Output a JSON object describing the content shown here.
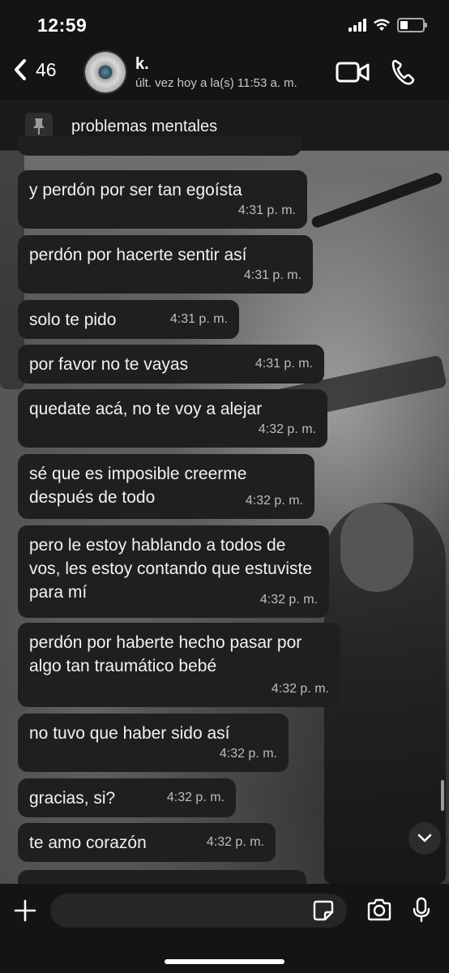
{
  "status_bar": {
    "time": "12:59"
  },
  "header": {
    "back_count": "46",
    "contact_name": "k.",
    "last_seen": "últ. vez hoy a la(s) 11:53 a. m."
  },
  "pinned": {
    "text": "problemas mentales"
  },
  "messages": [
    {
      "text": "y perdón por ser tan egoísta",
      "time": "4:31 p. m."
    },
    {
      "text": "perdón por hacerte sentir así",
      "time": "4:31 p. m."
    },
    {
      "text": "solo te pido",
      "time": "4:31 p. m."
    },
    {
      "text": "por favor no te vayas",
      "time": "4:31 p. m."
    },
    {
      "text": "quedate acá, no te voy a alejar",
      "time": "4:32 p. m."
    },
    {
      "text": "sé que es imposible creerme después de todo",
      "time": "4:32 p. m."
    },
    {
      "text": "pero le estoy hablando a todos de vos, les estoy contando que estuviste para mí",
      "time": "4:32 p. m."
    },
    {
      "text": "perdón por haberte hecho pasar por algo tan traumático bebé",
      "time": "4:32 p. m."
    },
    {
      "text": "no tuvo que haber sido así",
      "time": "4:32 p. m."
    },
    {
      "text": "gracias, si?",
      "time": "4:32 p. m."
    },
    {
      "text": "te amo corazón",
      "time": "4:32 p. m."
    }
  ],
  "input": {
    "placeholder": ""
  },
  "colors": {
    "bubble": "#1f1f1f",
    "bar": "#141414",
    "text": "#ffffff",
    "timestamp": "#bdbdbd"
  }
}
